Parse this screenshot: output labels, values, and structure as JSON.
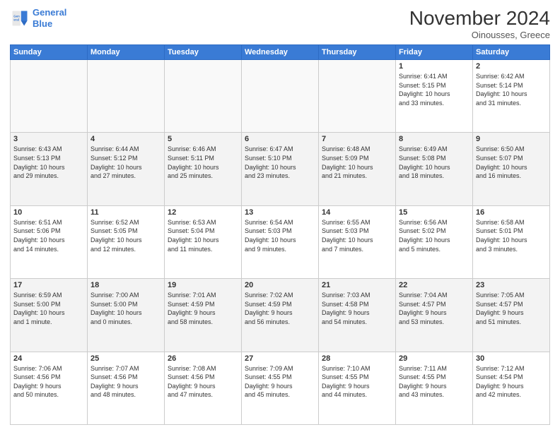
{
  "header": {
    "logo_line1": "General",
    "logo_line2": "Blue",
    "month": "November 2024",
    "location": "Oinousses, Greece"
  },
  "weekdays": [
    "Sunday",
    "Monday",
    "Tuesday",
    "Wednesday",
    "Thursday",
    "Friday",
    "Saturday"
  ],
  "weeks": [
    [
      {
        "day": "",
        "info": ""
      },
      {
        "day": "",
        "info": ""
      },
      {
        "day": "",
        "info": ""
      },
      {
        "day": "",
        "info": ""
      },
      {
        "day": "",
        "info": ""
      },
      {
        "day": "1",
        "info": "Sunrise: 6:41 AM\nSunset: 5:15 PM\nDaylight: 10 hours\nand 33 minutes."
      },
      {
        "day": "2",
        "info": "Sunrise: 6:42 AM\nSunset: 5:14 PM\nDaylight: 10 hours\nand 31 minutes."
      }
    ],
    [
      {
        "day": "3",
        "info": "Sunrise: 6:43 AM\nSunset: 5:13 PM\nDaylight: 10 hours\nand 29 minutes."
      },
      {
        "day": "4",
        "info": "Sunrise: 6:44 AM\nSunset: 5:12 PM\nDaylight: 10 hours\nand 27 minutes."
      },
      {
        "day": "5",
        "info": "Sunrise: 6:46 AM\nSunset: 5:11 PM\nDaylight: 10 hours\nand 25 minutes."
      },
      {
        "day": "6",
        "info": "Sunrise: 6:47 AM\nSunset: 5:10 PM\nDaylight: 10 hours\nand 23 minutes."
      },
      {
        "day": "7",
        "info": "Sunrise: 6:48 AM\nSunset: 5:09 PM\nDaylight: 10 hours\nand 21 minutes."
      },
      {
        "day": "8",
        "info": "Sunrise: 6:49 AM\nSunset: 5:08 PM\nDaylight: 10 hours\nand 18 minutes."
      },
      {
        "day": "9",
        "info": "Sunrise: 6:50 AM\nSunset: 5:07 PM\nDaylight: 10 hours\nand 16 minutes."
      }
    ],
    [
      {
        "day": "10",
        "info": "Sunrise: 6:51 AM\nSunset: 5:06 PM\nDaylight: 10 hours\nand 14 minutes."
      },
      {
        "day": "11",
        "info": "Sunrise: 6:52 AM\nSunset: 5:05 PM\nDaylight: 10 hours\nand 12 minutes."
      },
      {
        "day": "12",
        "info": "Sunrise: 6:53 AM\nSunset: 5:04 PM\nDaylight: 10 hours\nand 11 minutes."
      },
      {
        "day": "13",
        "info": "Sunrise: 6:54 AM\nSunset: 5:03 PM\nDaylight: 10 hours\nand 9 minutes."
      },
      {
        "day": "14",
        "info": "Sunrise: 6:55 AM\nSunset: 5:03 PM\nDaylight: 10 hours\nand 7 minutes."
      },
      {
        "day": "15",
        "info": "Sunrise: 6:56 AM\nSunset: 5:02 PM\nDaylight: 10 hours\nand 5 minutes."
      },
      {
        "day": "16",
        "info": "Sunrise: 6:58 AM\nSunset: 5:01 PM\nDaylight: 10 hours\nand 3 minutes."
      }
    ],
    [
      {
        "day": "17",
        "info": "Sunrise: 6:59 AM\nSunset: 5:00 PM\nDaylight: 10 hours\nand 1 minute."
      },
      {
        "day": "18",
        "info": "Sunrise: 7:00 AM\nSunset: 5:00 PM\nDaylight: 10 hours\nand 0 minutes."
      },
      {
        "day": "19",
        "info": "Sunrise: 7:01 AM\nSunset: 4:59 PM\nDaylight: 9 hours\nand 58 minutes."
      },
      {
        "day": "20",
        "info": "Sunrise: 7:02 AM\nSunset: 4:59 PM\nDaylight: 9 hours\nand 56 minutes."
      },
      {
        "day": "21",
        "info": "Sunrise: 7:03 AM\nSunset: 4:58 PM\nDaylight: 9 hours\nand 54 minutes."
      },
      {
        "day": "22",
        "info": "Sunrise: 7:04 AM\nSunset: 4:57 PM\nDaylight: 9 hours\nand 53 minutes."
      },
      {
        "day": "23",
        "info": "Sunrise: 7:05 AM\nSunset: 4:57 PM\nDaylight: 9 hours\nand 51 minutes."
      }
    ],
    [
      {
        "day": "24",
        "info": "Sunrise: 7:06 AM\nSunset: 4:56 PM\nDaylight: 9 hours\nand 50 minutes."
      },
      {
        "day": "25",
        "info": "Sunrise: 7:07 AM\nSunset: 4:56 PM\nDaylight: 9 hours\nand 48 minutes."
      },
      {
        "day": "26",
        "info": "Sunrise: 7:08 AM\nSunset: 4:56 PM\nDaylight: 9 hours\nand 47 minutes."
      },
      {
        "day": "27",
        "info": "Sunrise: 7:09 AM\nSunset: 4:55 PM\nDaylight: 9 hours\nand 45 minutes."
      },
      {
        "day": "28",
        "info": "Sunrise: 7:10 AM\nSunset: 4:55 PM\nDaylight: 9 hours\nand 44 minutes."
      },
      {
        "day": "29",
        "info": "Sunrise: 7:11 AM\nSunset: 4:55 PM\nDaylight: 9 hours\nand 43 minutes."
      },
      {
        "day": "30",
        "info": "Sunrise: 7:12 AM\nSunset: 4:54 PM\nDaylight: 9 hours\nand 42 minutes."
      }
    ]
  ]
}
